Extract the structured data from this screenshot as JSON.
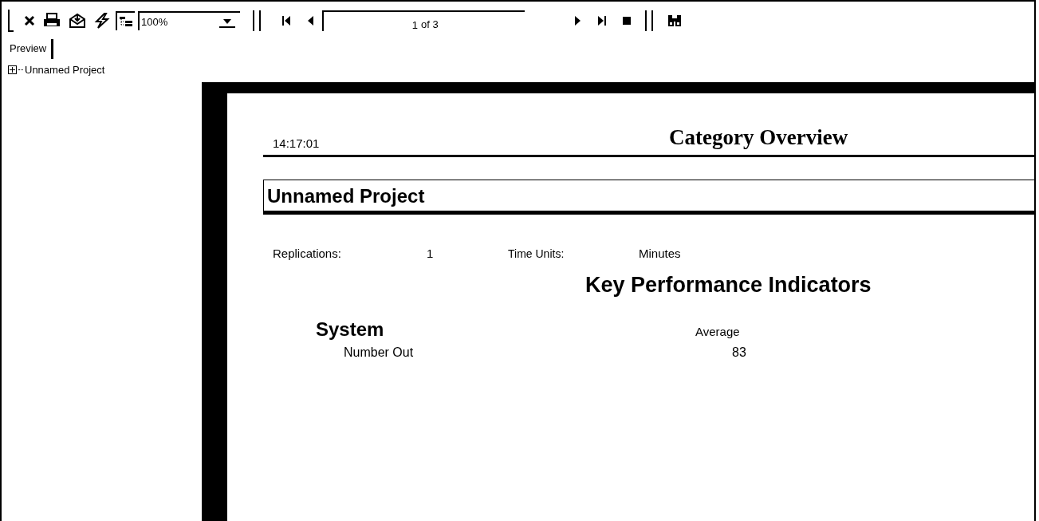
{
  "toolbar": {
    "zoom": "100%",
    "page": "1",
    "page_count": "of 3",
    "outline_pressed": true
  },
  "tabs": [
    {
      "label": "Preview",
      "selected": true
    }
  ],
  "tree": [
    {
      "label": "Unnamed Project",
      "expanded": false
    }
  ],
  "report": {
    "time": "14:17:01",
    "title": "Category Overview",
    "project": "Unnamed Project",
    "replications_label": "Replications:",
    "replications": "1",
    "time_units_label": "Time Units:",
    "time_units": "Minutes",
    "section": "Key Performance Indicators",
    "group": "System",
    "column": "Average",
    "rows": [
      {
        "label": "Number Out",
        "value": "83"
      }
    ]
  }
}
